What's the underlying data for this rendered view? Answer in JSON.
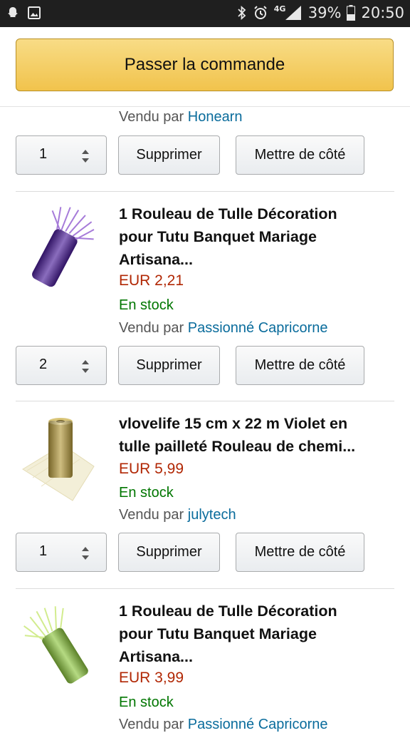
{
  "status_bar": {
    "network": "4G",
    "battery": "39%",
    "time": "20:50",
    "icons": [
      "snapchat-ghost-icon",
      "gallery-icon",
      "bluetooth-icon",
      "alarm-icon",
      "signal-icon",
      "battery-icon"
    ]
  },
  "checkout": {
    "label": "Passer la commande"
  },
  "items": [
    {
      "seller_prefix": "Vendu par ",
      "seller_name": "Honearn",
      "quantity": "1",
      "delete_label": "Supprimer",
      "save_label": "Mettre de côté"
    },
    {
      "title_lines": [
        "1 Rouleau de Tulle Décoration",
        "pour Tutu Banquet Mariage",
        "Artisana..."
      ],
      "price": "EUR 2,21",
      "stock": "En stock",
      "seller_prefix": "Vendu par ",
      "seller_name": "Passionné Capricorne",
      "quantity": "2",
      "delete_label": "Supprimer",
      "save_label": "Mettre de côté",
      "image_color": "#4b1e9a"
    },
    {
      "title_lines": [
        "vlovelife 15 cm x 22 m Violet en",
        "tulle pailleté Rouleau de chemi..."
      ],
      "price": "EUR 5,99",
      "stock": "En stock",
      "seller_prefix": "Vendu par ",
      "seller_name": "julytech",
      "quantity": "1",
      "delete_label": "Supprimer",
      "save_label": "Mettre de côté",
      "image_color": "#b59a3c"
    },
    {
      "title_lines": [
        "1 Rouleau de Tulle Décoration",
        "pour Tutu Banquet Mariage",
        "Artisana..."
      ],
      "price": "EUR 3,99",
      "stock": "En stock",
      "seller_prefix": "Vendu par ",
      "seller_name": "Passionné Capricorne",
      "image_color": "#8dc63f"
    }
  ],
  "colors": {
    "price": "#b12704",
    "in_stock": "#007600",
    "link": "#0a6c9c",
    "checkout_button": "#f1c34c"
  }
}
